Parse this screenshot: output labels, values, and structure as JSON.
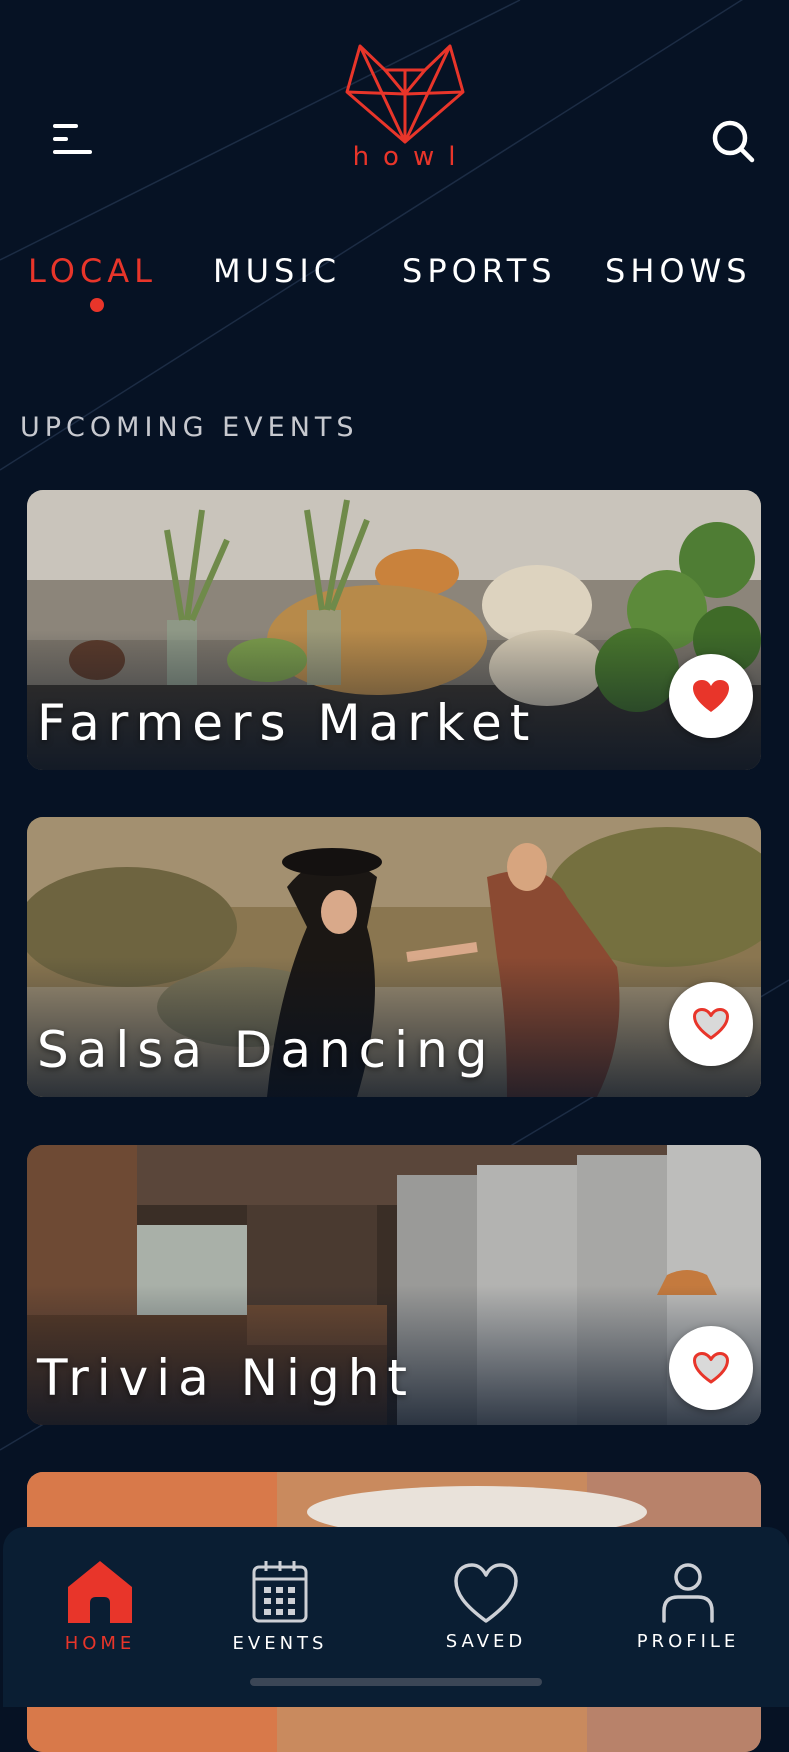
{
  "app": {
    "brand": "howl",
    "accent_color": "#e8352a",
    "background_color": "#061224"
  },
  "header": {
    "menu_icon": "hamburger-menu-icon",
    "logo_icon": "fox-head-logo-icon",
    "search_icon": "search-icon"
  },
  "categories": [
    {
      "label": "LOCAL",
      "active": true
    },
    {
      "label": "MUSIC",
      "active": false
    },
    {
      "label": "SPORTS",
      "active": false
    },
    {
      "label": "SHOWS",
      "active": false
    }
  ],
  "section": {
    "title": "UPCOMING EVENTS"
  },
  "events": [
    {
      "title": "Farmers Market",
      "saved": true,
      "image": "farmers-market-produce-photo"
    },
    {
      "title": "Salsa Dancing",
      "saved": false,
      "image": "couple-dancing-desert-photo"
    },
    {
      "title": "Trivia Night",
      "saved": false,
      "image": "brewery-interior-photo"
    },
    {
      "title": "",
      "saved": false,
      "image": "coffee-cup-photo"
    }
  ],
  "tabbar": {
    "items": [
      {
        "label": "HOME",
        "icon": "home-icon",
        "active": true
      },
      {
        "label": "EVENTS",
        "icon": "calendar-icon",
        "active": false
      },
      {
        "label": "SAVED",
        "icon": "heart-icon",
        "active": false
      },
      {
        "label": "PROFILE",
        "icon": "user-icon",
        "active": false
      }
    ]
  }
}
